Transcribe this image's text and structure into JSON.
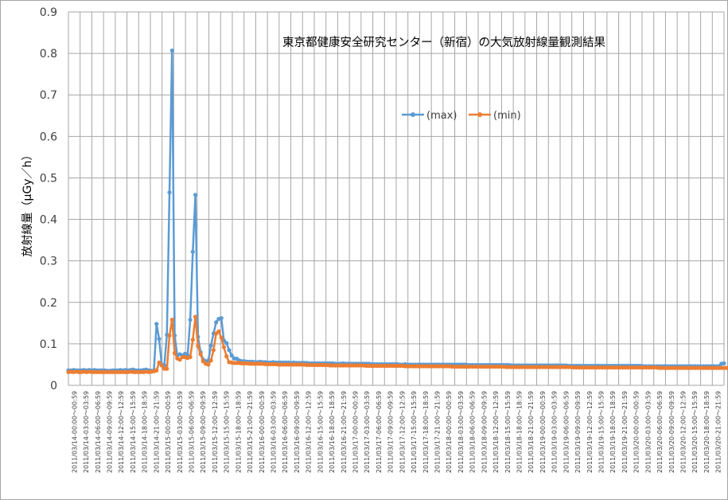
{
  "chart_data": {
    "type": "line",
    "title": "東京都健康安全研究センター（新宿）の大気放射線量観測結果",
    "xlabel": "",
    "ylabel": "放射線量（μGy／h）",
    "ylim": [
      0,
      0.9
    ],
    "yticks": [
      "0",
      "0.1",
      "0.2",
      "0.3",
      "0.4",
      "0.5",
      "0.6",
      "0.7",
      "0.8",
      "0.9"
    ],
    "grid": true,
    "legend_position": "center-right",
    "x_tick_labels": [
      "2011/03/14-00:00～00:59",
      "2011/03/14-03:00～03:59",
      "2011/03/14-06:00～06:59",
      "2011/03/14-09:00～09:59",
      "2011/03/14-12:00～12:59",
      "2011/03/14-15:00～15:59",
      "2011/03/14-18:00～18:59",
      "2011/03/14-21:00～21:59",
      "2011/03/15-00:00～00:59",
      "2011/03/15-03:00～03:59",
      "2011/03/15-06:00～06:59",
      "2011/03/15-09:00～09:59",
      "2011/03/15-12:00～12:59",
      "2011/03/15-15:00～15:59",
      "2011/03/15-18:00～18:59",
      "2011/03/15-21:00～21:59",
      "2011/03/16-00:00～00:59",
      "2011/03/16-03:00～03:59",
      "2011/03/16-06:00～06:59",
      "2011/03/16-09:00～09:59",
      "2011/03/16-12:00～12:59",
      "2011/03/16-15:00～15:59",
      "2011/03/16-18:00～18:59",
      "2011/03/16-21:00～21:59",
      "2011/03/17-00:00～00:59",
      "2011/03/17-03:00～03:59",
      "2011/03/17-06:00～06:59",
      "2011/03/17-09:00～09:59",
      "2011/03/17-12:00～12:59",
      "2011/03/17-15:00～15:59",
      "2011/03/17-18:00～18:59",
      "2011/03/17-21:00～21:59",
      "2011/03/18-00:00～00:59",
      "2011/03/18-03:00～03:59",
      "2011/03/18-06:00～06:59",
      "2011/03/18-09:00～09:59",
      "2011/03/18-12:00～12:59",
      "2011/03/18-15:00～15:59",
      "2011/03/18-18:00～18:59",
      "2011/03/18-21:00～21:59",
      "2011/03/19-00:00～00:59",
      "2011/03/19-03:00～03:59",
      "2011/03/19-06:00～06:59",
      "2011/03/19-09:00～09:59",
      "2011/03/19-12:00～12:59",
      "2011/03/19-15:00～15:59",
      "2011/03/19-18:00～18:59",
      "2011/03/19-21:00～21:59",
      "2011/03/20-00:00～00:59",
      "2011/03/20-03:00～03:59",
      "2011/03/20-06:00～06:59",
      "2011/03/20-09:00～09:59",
      "2011/03/20-12:00～12:59",
      "2011/03/20-15:00～15:59",
      "2011/03/20-18:00～18:59",
      "2011/03/20-21:00～21:59"
    ],
    "series": [
      {
        "name": "(max)",
        "color": "#5b9bd5",
        "values": [
          0.036,
          0.036,
          0.037,
          0.036,
          0.036,
          0.036,
          0.037,
          0.036,
          0.037,
          0.036,
          0.037,
          0.036,
          0.036,
          0.036,
          0.036,
          0.035,
          0.035,
          0.036,
          0.036,
          0.036,
          0.037,
          0.036,
          0.037,
          0.036,
          0.037,
          0.038,
          0.036,
          0.036,
          0.036,
          0.037,
          0.038,
          0.036,
          0.035,
          0.036,
          0.148,
          0.112,
          0.05,
          0.048,
          0.122,
          0.465,
          0.807,
          0.12,
          0.072,
          0.075,
          0.072,
          0.076,
          0.072,
          0.158,
          0.322,
          0.459,
          0.117,
          0.08,
          0.062,
          0.058,
          0.06,
          0.096,
          0.125,
          0.152,
          0.16,
          0.162,
          0.108,
          0.102,
          0.085,
          0.072,
          0.065,
          0.064,
          0.06,
          0.058,
          0.058,
          0.057,
          0.057,
          0.057,
          0.056,
          0.056,
          0.057,
          0.056,
          0.056,
          0.055,
          0.055,
          0.056,
          0.055,
          0.055,
          0.055,
          0.055,
          0.055,
          0.055,
          0.054,
          0.055,
          0.054,
          0.054,
          0.054,
          0.054,
          0.054,
          0.053,
          0.053,
          0.053,
          0.053,
          0.053,
          0.053,
          0.053,
          0.053,
          0.053,
          0.053,
          0.052,
          0.052,
          0.052,
          0.053,
          0.052,
          0.052,
          0.052,
          0.052,
          0.052,
          0.052,
          0.052,
          0.052,
          0.052,
          0.052,
          0.051,
          0.051,
          0.051,
          0.051,
          0.051,
          0.051,
          0.051,
          0.051,
          0.051,
          0.051,
          0.051,
          0.05,
          0.05,
          0.051,
          0.05,
          0.05,
          0.05,
          0.05,
          0.05,
          0.05,
          0.05,
          0.05,
          0.05,
          0.05,
          0.05,
          0.05,
          0.05,
          0.05,
          0.05,
          0.05,
          0.05,
          0.05,
          0.05,
          0.05,
          0.05,
          0.05,
          0.05,
          0.049,
          0.049,
          0.049,
          0.049,
          0.049,
          0.049,
          0.049,
          0.049,
          0.049,
          0.049,
          0.049,
          0.049,
          0.049,
          0.049,
          0.049,
          0.049,
          0.049,
          0.048,
          0.048,
          0.048,
          0.048,
          0.048,
          0.048,
          0.048,
          0.048,
          0.048,
          0.048,
          0.048,
          0.048,
          0.048,
          0.048,
          0.048,
          0.048,
          0.048,
          0.048,
          0.048,
          0.048,
          0.048,
          0.048,
          0.047,
          0.047,
          0.047,
          0.047,
          0.047,
          0.047,
          0.047,
          0.047,
          0.047,
          0.047,
          0.047,
          0.047,
          0.047,
          0.047,
          0.047,
          0.047,
          0.047,
          0.047,
          0.047,
          0.047,
          0.047,
          0.047,
          0.047,
          0.047,
          0.047,
          0.047,
          0.047,
          0.047,
          0.047,
          0.046,
          0.046,
          0.046,
          0.046,
          0.046,
          0.046,
          0.046,
          0.046,
          0.046,
          0.046,
          0.046,
          0.046,
          0.046,
          0.046,
          0.046,
          0.046,
          0.046,
          0.046,
          0.046,
          0.046,
          0.046,
          0.046,
          0.046,
          0.046,
          0.046,
          0.046,
          0.046,
          0.046,
          0.046,
          0.046,
          0.052,
          0.053
        ]
      },
      {
        "name": "(min)",
        "color": "#ed7d31",
        "values": [
          0.032,
          0.033,
          0.032,
          0.033,
          0.032,
          0.032,
          0.033,
          0.032,
          0.033,
          0.032,
          0.032,
          0.032,
          0.032,
          0.032,
          0.032,
          0.032,
          0.032,
          0.032,
          0.032,
          0.032,
          0.032,
          0.032,
          0.032,
          0.032,
          0.033,
          0.032,
          0.032,
          0.032,
          0.032,
          0.032,
          0.033,
          0.032,
          0.033,
          0.034,
          0.036,
          0.055,
          0.048,
          0.04,
          0.04,
          0.12,
          0.158,
          0.078,
          0.065,
          0.062,
          0.068,
          0.068,
          0.066,
          0.068,
          0.11,
          0.165,
          0.095,
          0.075,
          0.058,
          0.052,
          0.05,
          0.06,
          0.085,
          0.125,
          0.13,
          0.115,
          0.092,
          0.07,
          0.056,
          0.055,
          0.054,
          0.054,
          0.054,
          0.053,
          0.053,
          0.053,
          0.052,
          0.052,
          0.052,
          0.052,
          0.052,
          0.052,
          0.051,
          0.051,
          0.051,
          0.051,
          0.051,
          0.05,
          0.05,
          0.05,
          0.05,
          0.05,
          0.05,
          0.05,
          0.05,
          0.05,
          0.05,
          0.05,
          0.049,
          0.049,
          0.049,
          0.049,
          0.049,
          0.049,
          0.049,
          0.049,
          0.049,
          0.048,
          0.048,
          0.048,
          0.048,
          0.048,
          0.048,
          0.048,
          0.048,
          0.048,
          0.048,
          0.048,
          0.048,
          0.048,
          0.048,
          0.047,
          0.047,
          0.047,
          0.047,
          0.047,
          0.047,
          0.047,
          0.047,
          0.047,
          0.047,
          0.047,
          0.047,
          0.047,
          0.047,
          0.047,
          0.046,
          0.046,
          0.046,
          0.046,
          0.046,
          0.046,
          0.046,
          0.046,
          0.046,
          0.046,
          0.046,
          0.046,
          0.046,
          0.046,
          0.046,
          0.046,
          0.046,
          0.046,
          0.045,
          0.045,
          0.045,
          0.045,
          0.045,
          0.045,
          0.045,
          0.045,
          0.045,
          0.045,
          0.045,
          0.045,
          0.045,
          0.045,
          0.045,
          0.045,
          0.045,
          0.045,
          0.045,
          0.045,
          0.045,
          0.044,
          0.044,
          0.044,
          0.044,
          0.044,
          0.044,
          0.044,
          0.044,
          0.044,
          0.044,
          0.044,
          0.044,
          0.044,
          0.044,
          0.044,
          0.044,
          0.044,
          0.044,
          0.044,
          0.044,
          0.044,
          0.044,
          0.044,
          0.044,
          0.044,
          0.044,
          0.043,
          0.043,
          0.043,
          0.043,
          0.043,
          0.043,
          0.043,
          0.043,
          0.043,
          0.043,
          0.043,
          0.043,
          0.043,
          0.043,
          0.043,
          0.043,
          0.043,
          0.043,
          0.043,
          0.043,
          0.043,
          0.043,
          0.043,
          0.043,
          0.043,
          0.043,
          0.043,
          0.043,
          0.043,
          0.043,
          0.043,
          0.043,
          0.043,
          0.042,
          0.042,
          0.042,
          0.042,
          0.042,
          0.042,
          0.042,
          0.042,
          0.042,
          0.042,
          0.042,
          0.042,
          0.042,
          0.042,
          0.042,
          0.042,
          0.042,
          0.042,
          0.042,
          0.042,
          0.042,
          0.042,
          0.042,
          0.042,
          0.042,
          0.042,
          0.042,
          0.042,
          0.042,
          0.046,
          0.047
        ]
      }
    ]
  }
}
